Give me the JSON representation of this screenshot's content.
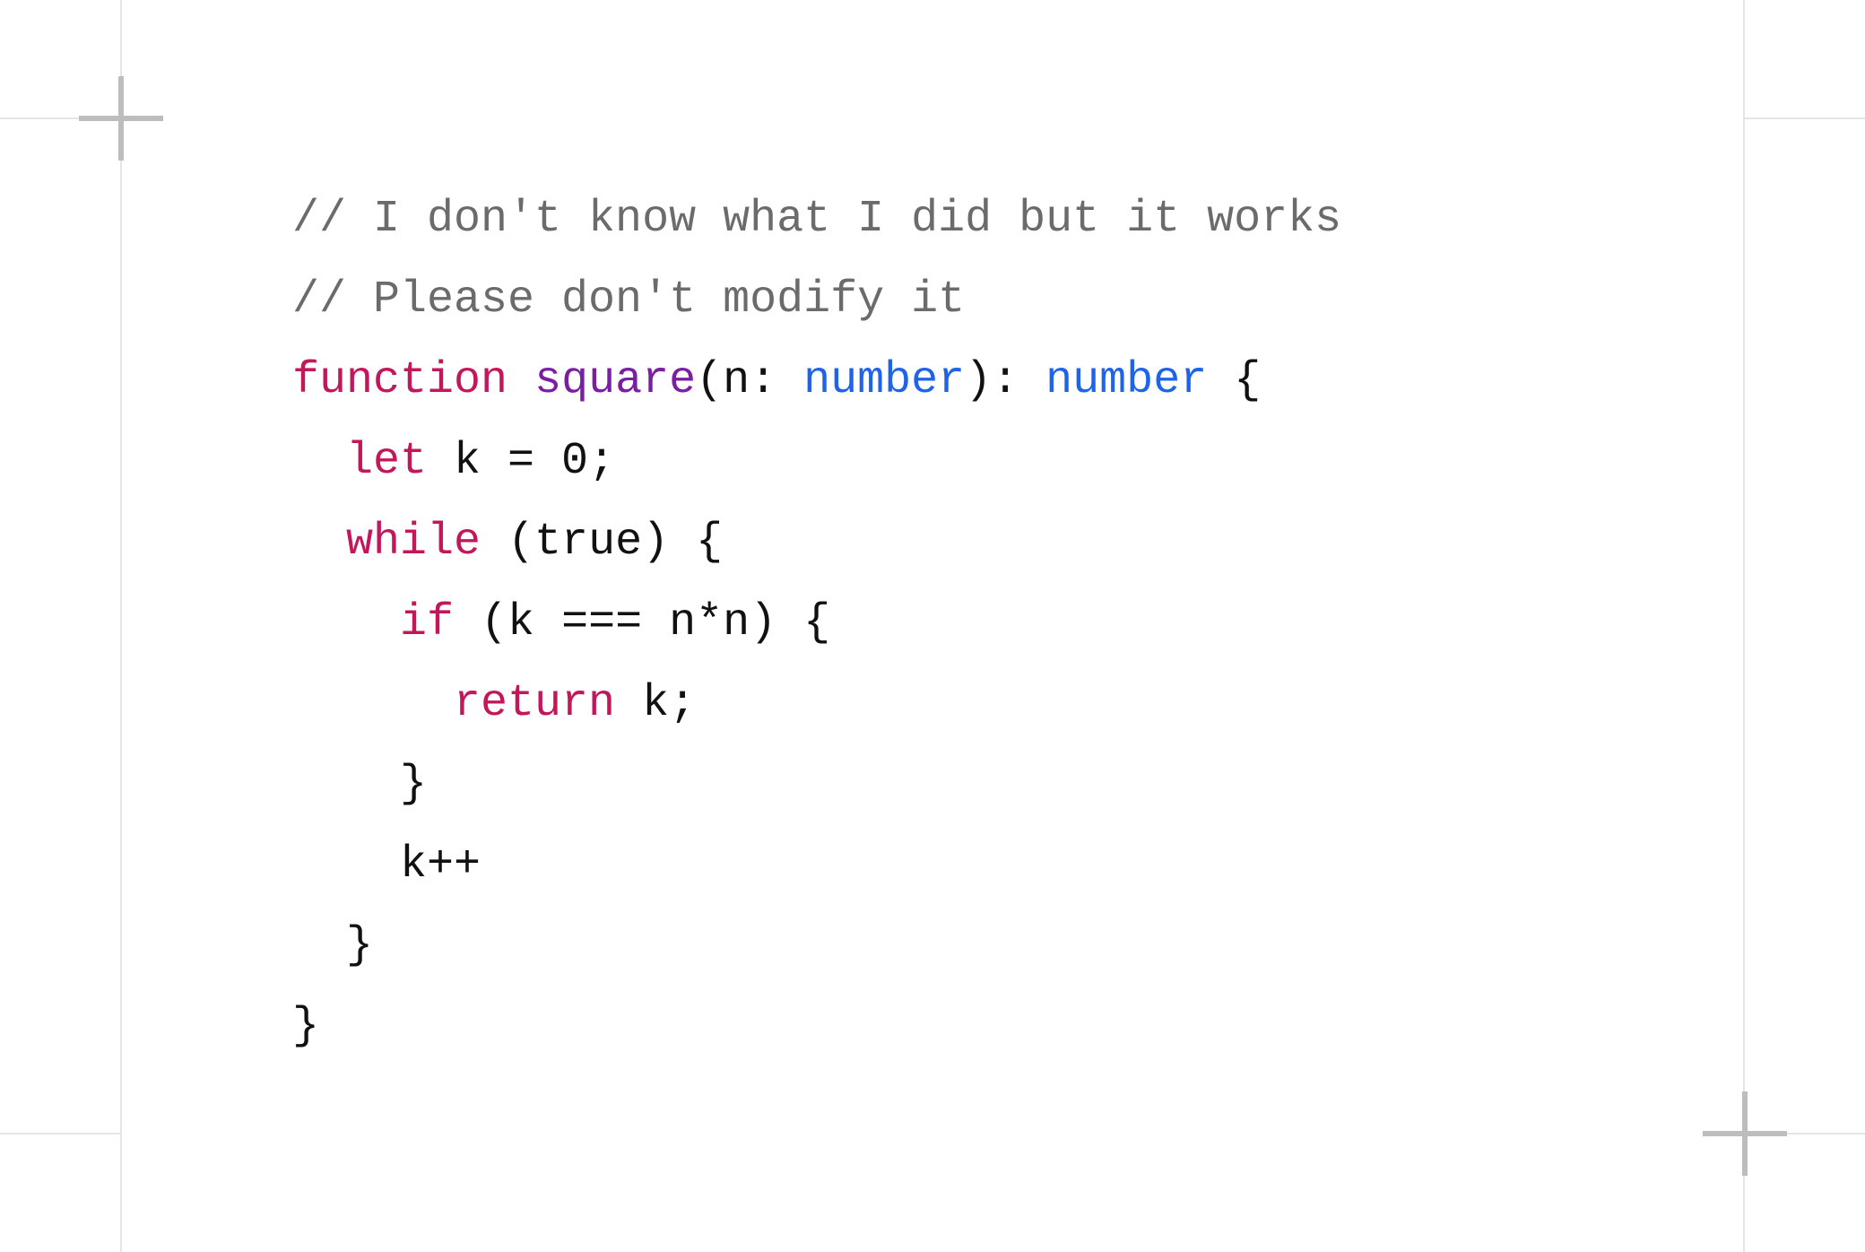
{
  "code": {
    "lines": [
      {
        "indent": 0,
        "tokens": [
          {
            "cls": "tok-comment",
            "text": "// I don't know what I did but it works"
          }
        ]
      },
      {
        "indent": 0,
        "tokens": [
          {
            "cls": "tok-comment",
            "text": "// Please don't modify it"
          }
        ]
      },
      {
        "indent": 0,
        "tokens": [
          {
            "cls": "tok-keyword",
            "text": "function"
          },
          {
            "cls": "tok-default",
            "text": " "
          },
          {
            "cls": "tok-funcname",
            "text": "square"
          },
          {
            "cls": "tok-default",
            "text": "(n: "
          },
          {
            "cls": "tok-type",
            "text": "number"
          },
          {
            "cls": "tok-default",
            "text": "): "
          },
          {
            "cls": "tok-type",
            "text": "number"
          },
          {
            "cls": "tok-default",
            "text": " {"
          }
        ]
      },
      {
        "indent": 1,
        "tokens": [
          {
            "cls": "tok-keyword",
            "text": "let"
          },
          {
            "cls": "tok-default",
            "text": " k = 0;"
          }
        ]
      },
      {
        "indent": 1,
        "tokens": [
          {
            "cls": "tok-keyword",
            "text": "while"
          },
          {
            "cls": "tok-default",
            "text": " (true) {"
          }
        ]
      },
      {
        "indent": 2,
        "tokens": [
          {
            "cls": "tok-keyword",
            "text": "if"
          },
          {
            "cls": "tok-default",
            "text": " (k === n*n) {"
          }
        ]
      },
      {
        "indent": 3,
        "tokens": [
          {
            "cls": "tok-keyword",
            "text": "return"
          },
          {
            "cls": "tok-default",
            "text": " k;"
          }
        ]
      },
      {
        "indent": 2,
        "tokens": [
          {
            "cls": "tok-default",
            "text": "}"
          }
        ]
      },
      {
        "indent": 2,
        "tokens": [
          {
            "cls": "tok-default",
            "text": "k++"
          }
        ]
      },
      {
        "indent": 1,
        "tokens": [
          {
            "cls": "tok-default",
            "text": "}"
          }
        ]
      },
      {
        "indent": 0,
        "tokens": [
          {
            "cls": "tok-default",
            "text": "}"
          }
        ]
      }
    ],
    "indent_unit": "  "
  }
}
